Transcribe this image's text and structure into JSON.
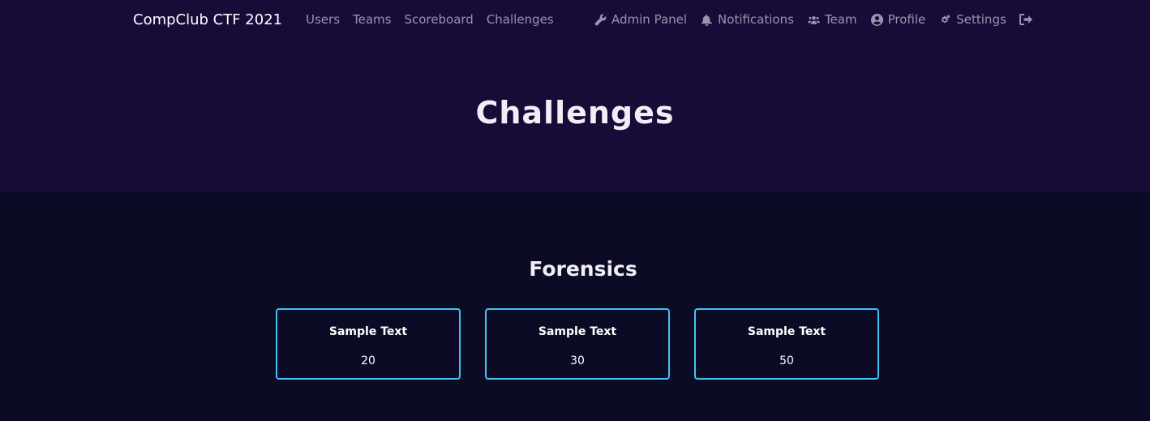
{
  "navbar": {
    "brand": "CompClub CTF 2021",
    "left_links": [
      "Users",
      "Teams",
      "Scoreboard",
      "Challenges"
    ],
    "right_links": [
      {
        "label": "Admin Panel",
        "icon": "wrench-icon"
      },
      {
        "label": "Notifications",
        "icon": "bell-icon"
      },
      {
        "label": "Team",
        "icon": "users-icon"
      },
      {
        "label": "Profile",
        "icon": "user-circle-icon"
      },
      {
        "label": "Settings",
        "icon": "cogs-icon"
      }
    ],
    "logout_icon": "sign-out-icon"
  },
  "page": {
    "title": "Challenges"
  },
  "categories": [
    {
      "name": "Forensics",
      "challenges": [
        {
          "name": "Sample Text",
          "value": "20"
        },
        {
          "name": "Sample Text",
          "value": "30"
        },
        {
          "name": "Sample Text",
          "value": "50"
        }
      ]
    }
  ],
  "colors": {
    "header_bg": "#170c38",
    "page_bg": "#0c0b25",
    "card_border": "#3fc3ef",
    "nav_text": "#9795ac"
  }
}
